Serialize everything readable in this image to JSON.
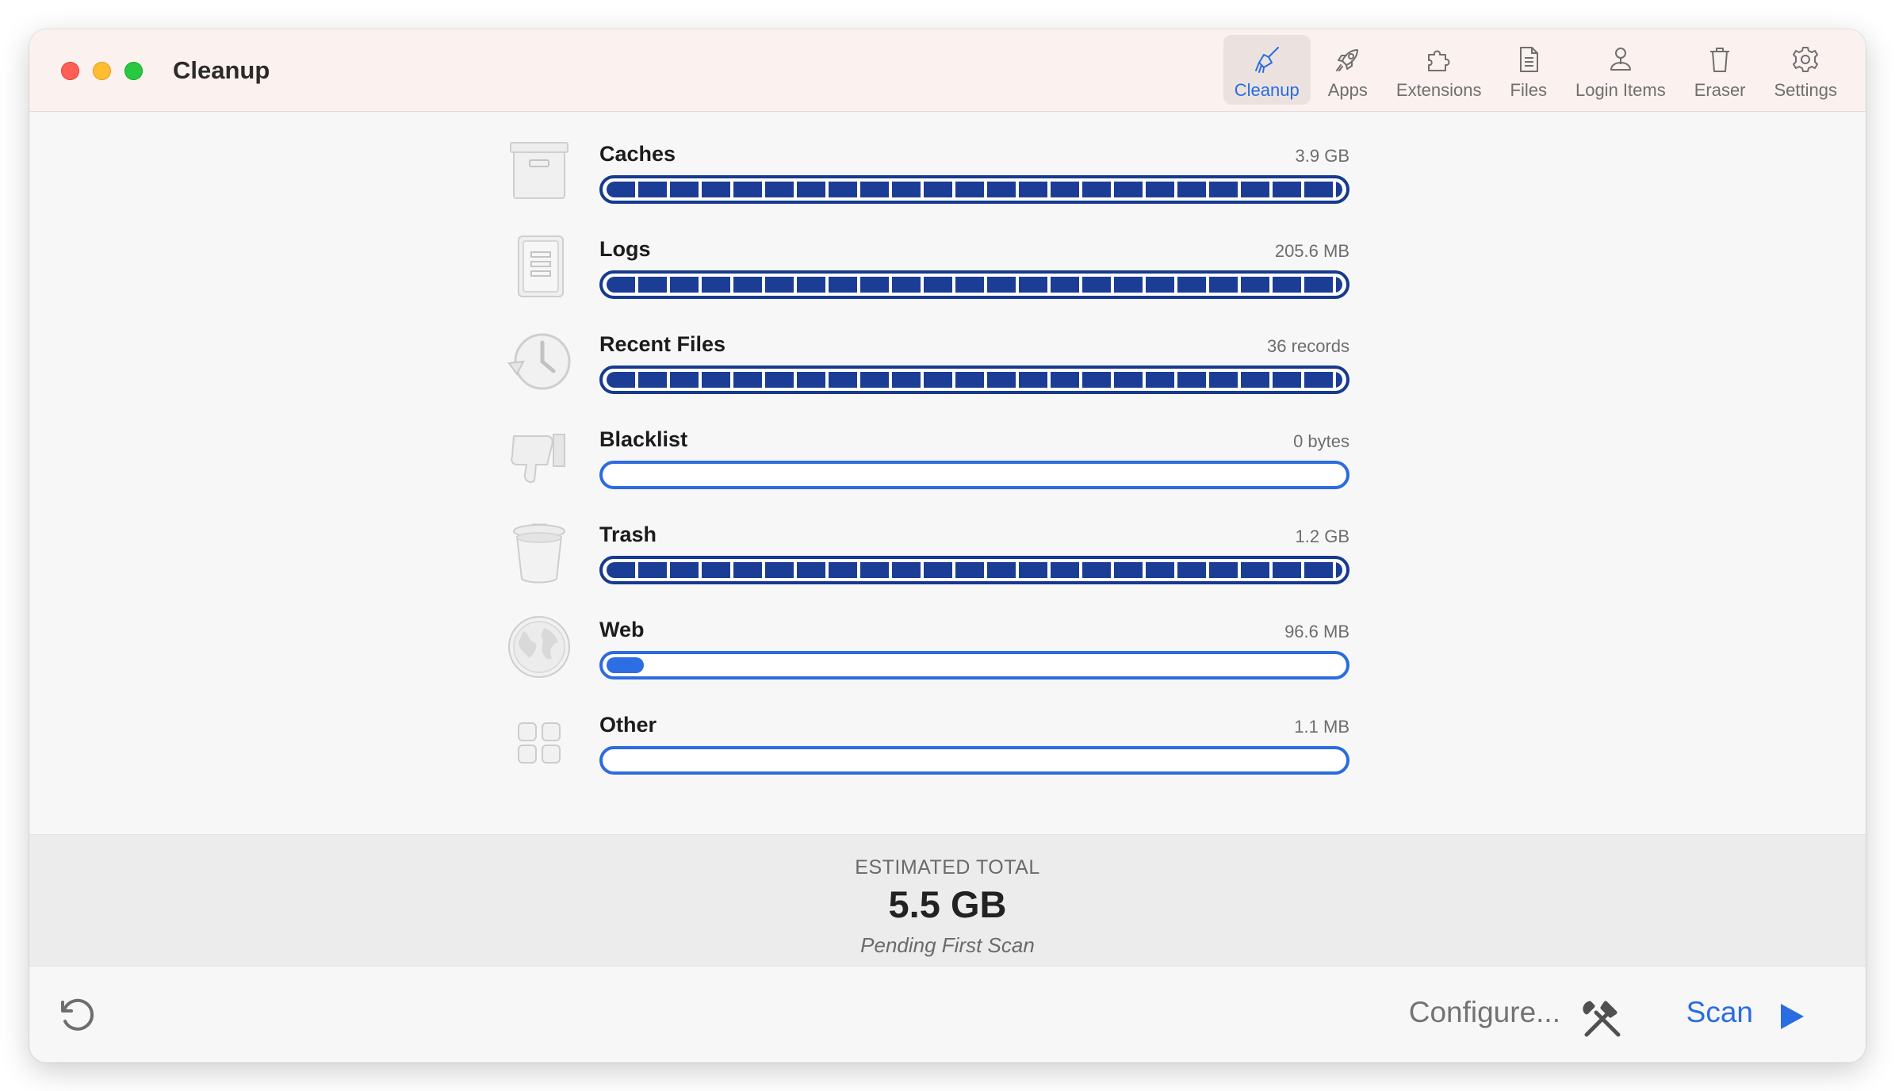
{
  "window": {
    "title": "Cleanup"
  },
  "toolbar": {
    "items": [
      {
        "label": "Cleanup",
        "icon": "broom-icon",
        "active": true
      },
      {
        "label": "Apps",
        "icon": "rocket-icon",
        "active": false
      },
      {
        "label": "Extensions",
        "icon": "puzzle-icon",
        "active": false
      },
      {
        "label": "Files",
        "icon": "document-icon",
        "active": false
      },
      {
        "label": "Login Items",
        "icon": "person-icon",
        "active": false
      },
      {
        "label": "Eraser",
        "icon": "trash-icon",
        "active": false
      },
      {
        "label": "Settings",
        "icon": "gear-icon",
        "active": false
      }
    ]
  },
  "categories": [
    {
      "name": "Caches",
      "value": "3.9 GB",
      "icon": "archive-box-icon",
      "fill_fraction": 1.0
    },
    {
      "name": "Logs",
      "value": "205.6 MB",
      "icon": "log-document-icon",
      "fill_fraction": 1.0
    },
    {
      "name": "Recent Files",
      "value": "36 records",
      "icon": "clock-history-icon",
      "fill_fraction": 1.0
    },
    {
      "name": "Blacklist",
      "value": "0 bytes",
      "icon": "thumbs-down-icon",
      "fill_fraction": 0.0
    },
    {
      "name": "Trash",
      "value": "1.2 GB",
      "icon": "trash-can-icon",
      "fill_fraction": 1.0
    },
    {
      "name": "Web",
      "value": "96.6 MB",
      "icon": "globe-icon",
      "fill_fraction": 0.05
    },
    {
      "name": "Other",
      "value": "1.1 MB",
      "icon": "grid-squares-icon",
      "fill_fraction": 0.0
    }
  ],
  "summary": {
    "label": "ESTIMATED TOTAL",
    "total": "5.5 GB",
    "status": "Pending First Scan"
  },
  "footer": {
    "configure_label": "Configure...",
    "scan_label": "Scan",
    "refresh_icon": "refresh-icon",
    "tools_icon": "tools-icon",
    "play_icon": "play-icon"
  },
  "colors": {
    "accent": "#2a6ce2",
    "bar_fill": "#1c3d96",
    "titlebar": "#fbf1ee"
  }
}
